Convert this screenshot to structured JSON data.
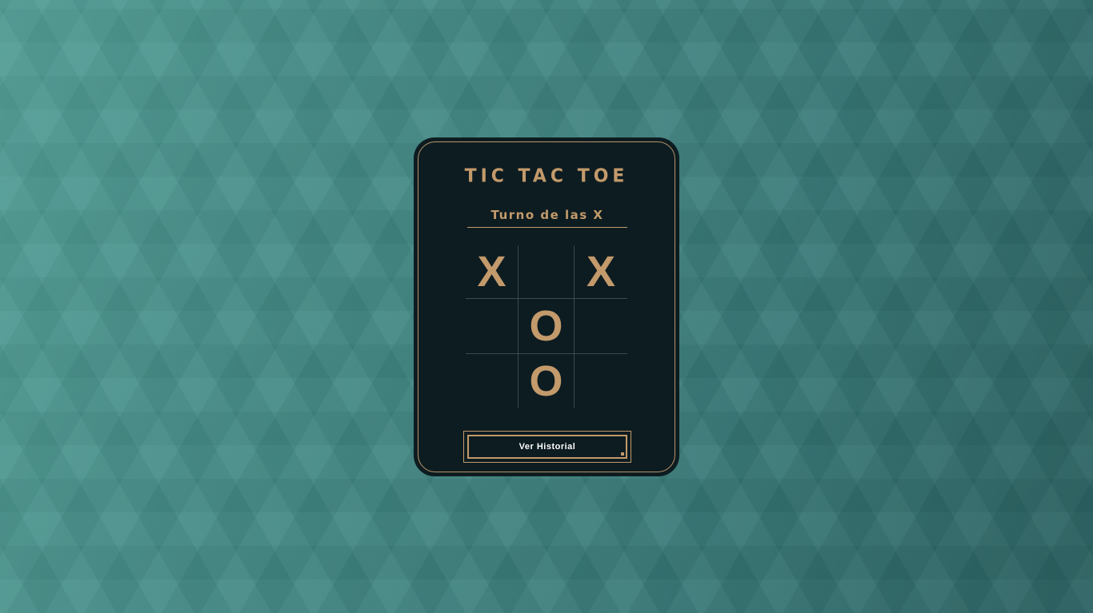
{
  "game": {
    "title": "TIC TAC TOE",
    "turn_text": "Turno de las X",
    "board": [
      [
        "X",
        "",
        "X"
      ],
      [
        "",
        "O",
        ""
      ],
      [
        "",
        "O",
        ""
      ]
    ],
    "history_button_label": "Ver Historial"
  },
  "colors": {
    "accent": "#c39a6b",
    "card_background": "#0d1c21",
    "page_background": "#3e8582"
  }
}
